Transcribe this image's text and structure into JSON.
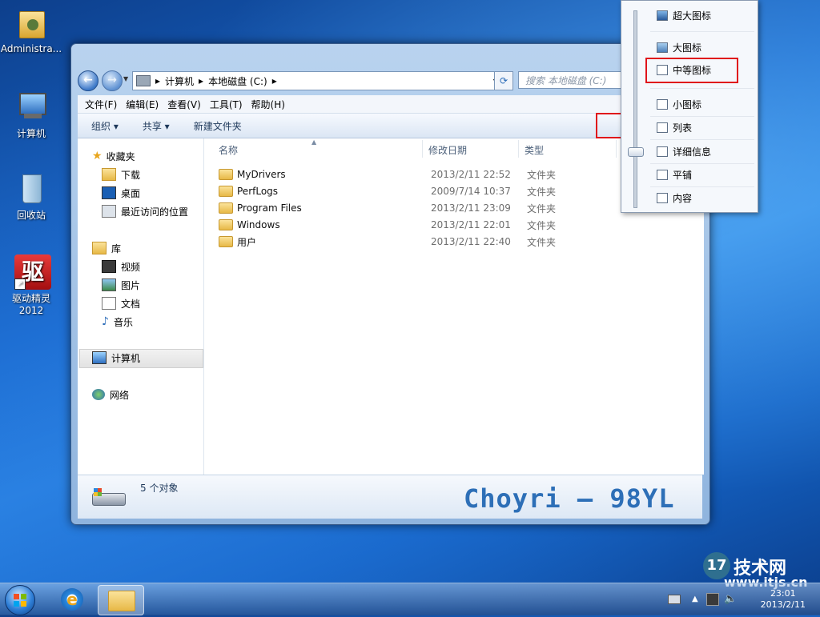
{
  "desktop": {
    "icons": [
      {
        "label": "Administra..."
      },
      {
        "label": "计算机"
      },
      {
        "label": "回收站"
      },
      {
        "label": "驱动精灵\n2012",
        "label_line1": "驱动精灵",
        "label_line2": "2012",
        "badge": "驱"
      }
    ]
  },
  "explorer": {
    "address": {
      "crumbs": [
        "计算机",
        "本地磁盘 (C:)"
      ]
    },
    "search_placeholder": "搜索 本地磁盘 (C:)",
    "menu": [
      "文件(F)",
      "编辑(E)",
      "查看(V)",
      "工具(T)",
      "帮助(H)"
    ],
    "toolbar": {
      "organize": "组织 ▾",
      "share": "共享 ▾",
      "new_folder": "新建文件夹"
    },
    "nav": {
      "favorites": "收藏夹",
      "downloads": "下载",
      "desktop": "桌面",
      "recent": "最近访问的位置",
      "libraries": "库",
      "videos": "视频",
      "pictures": "图片",
      "documents": "文档",
      "music": "音乐",
      "computer": "计算机",
      "network": "网络"
    },
    "columns": {
      "name": "名称",
      "date": "修改日期",
      "type": "类型"
    },
    "files": [
      {
        "name": "MyDrivers",
        "date": "2013/2/11 22:52",
        "type": "文件夹"
      },
      {
        "name": "PerfLogs",
        "date": "2009/7/14 10:37",
        "type": "文件夹"
      },
      {
        "name": "Program Files",
        "date": "2013/2/11 23:09",
        "type": "文件夹"
      },
      {
        "name": "Windows",
        "date": "2013/2/11 22:01",
        "type": "文件夹"
      },
      {
        "name": "用户",
        "date": "2013/2/11 22:40",
        "type": "文件夹"
      }
    ],
    "status": {
      "count": "5 个对象"
    },
    "watermark": "Choyri — 98YL"
  },
  "view_menu": {
    "options": [
      "超大图标",
      "大图标",
      "中等图标",
      "小图标",
      "列表",
      "详细信息",
      "平铺",
      "内容"
    ],
    "highlighted": "中等图标"
  },
  "overlay": {
    "site_logo_text": "技术网",
    "site_url": "www.itjs.cn"
  },
  "taskbar": {
    "time": "23:01",
    "date": "2013/2/11"
  },
  "colors": {
    "highlight_box": "#e0141b",
    "watermark": "#2d6fb7"
  }
}
